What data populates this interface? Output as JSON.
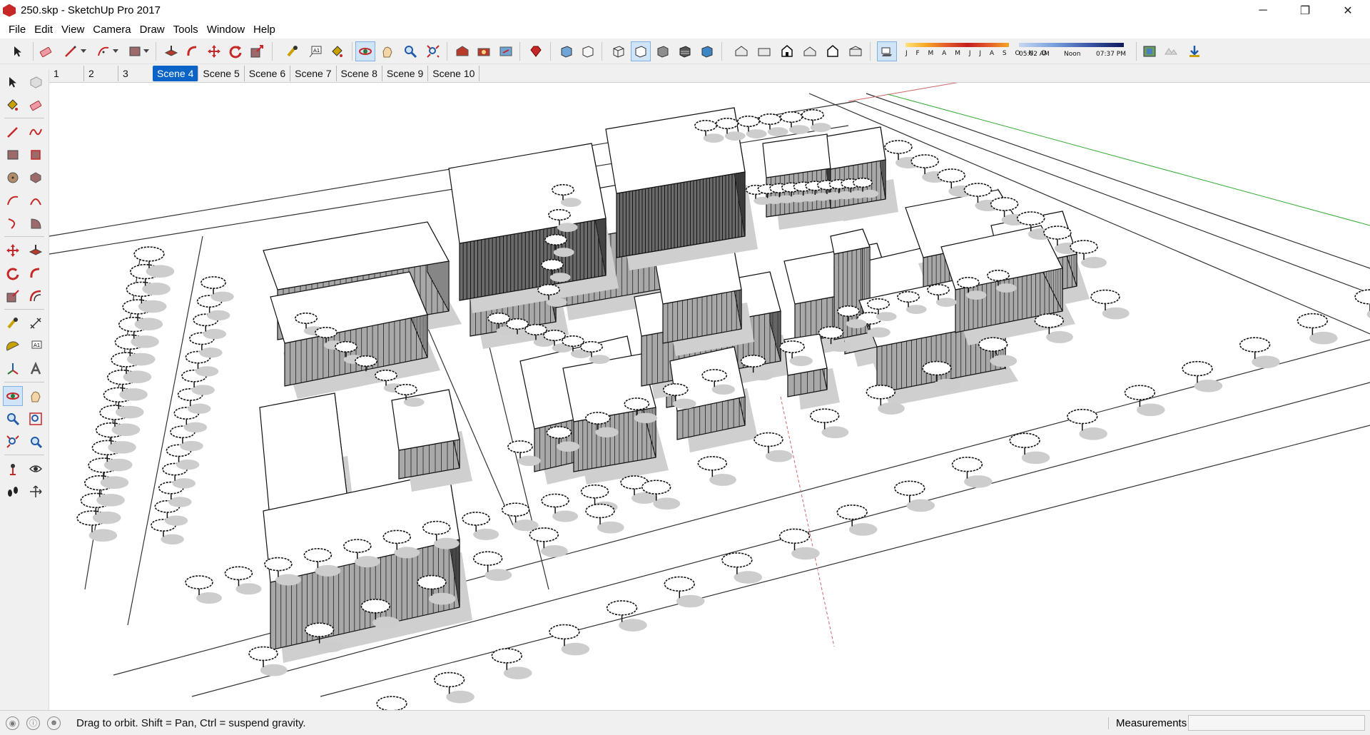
{
  "window": {
    "title": "250.skp - SketchUp Pro 2017",
    "minimize": "─",
    "maximize": "❐",
    "close": "✕"
  },
  "menu": [
    "File",
    "Edit",
    "View",
    "Camera",
    "Draw",
    "Tools",
    "Window",
    "Help"
  ],
  "shadow_widget": {
    "months": "J F M A M J J A S O N D",
    "time_start": "05:02 AM",
    "time_mid": "Noon",
    "time_end": "07:37 PM"
  },
  "scene_tabs": [
    "1",
    "2",
    "3",
    "Scene 4",
    "Scene 5",
    "Scene 6",
    "Scene 7",
    "Scene 8",
    "Scene 9",
    "Scene 10"
  ],
  "active_scene": "Scene 4",
  "status": {
    "hint": "Drag to orbit. Shift = Pan, Ctrl = suspend gravity.",
    "measurements_label": "Measurements",
    "measurements_value": ""
  }
}
